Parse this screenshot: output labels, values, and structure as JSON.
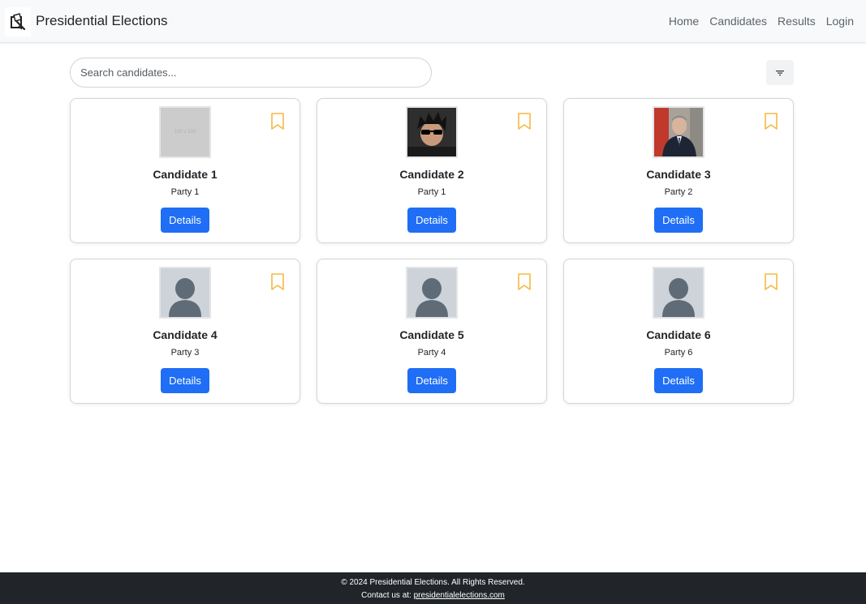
{
  "navbar": {
    "brand_icon": "ballot-box-icon",
    "title": "Presidential Elections",
    "links": [
      "Home",
      "Candidates",
      "Results",
      "Login"
    ]
  },
  "search": {
    "placeholder": "Search candidates...",
    "filter_icon": "filter-icon"
  },
  "colors": {
    "primary": "#1f6ef5",
    "bookmark": "#f5b942",
    "footer_bg": "#212529"
  },
  "candidates": [
    {
      "name": "Candidate 1",
      "party": "Party 1",
      "photo": "placeholder",
      "placeholder_text": "100 x 100",
      "button": "Details"
    },
    {
      "name": "Candidate 2",
      "party": "Party 1",
      "photo": "avatar-sunglasses",
      "button": "Details"
    },
    {
      "name": "Candidate 3",
      "party": "Party 2",
      "photo": "portrait-suit",
      "button": "Details"
    },
    {
      "name": "Candidate 4",
      "party": "Party 3",
      "photo": "default-user",
      "button": "Details"
    },
    {
      "name": "Candidate 5",
      "party": "Party 4",
      "photo": "default-user",
      "button": "Details"
    },
    {
      "name": "Candidate 6",
      "party": "Party 6",
      "photo": "default-user",
      "button": "Details"
    }
  ],
  "footer": {
    "copyright": "© 2024 Presidential Elections. All Rights Reserved.",
    "contact_prefix": "Contact us at: ",
    "contact_link": "presidentialelections.com"
  }
}
